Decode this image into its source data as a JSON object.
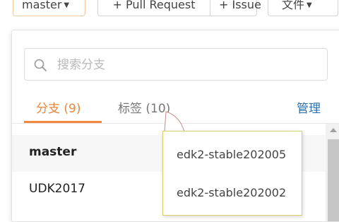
{
  "toolbar": {
    "branch_label": "master",
    "pull_request_label": "+ Pull Request",
    "issue_label": "+ Issue",
    "file_label": "文件"
  },
  "branch_panel": {
    "search_placeholder": "搜索分支",
    "tabs": [
      {
        "label": "分支 (9)",
        "active": true
      },
      {
        "label": "标签 (10)",
        "active": false
      }
    ],
    "manage_label": "管理",
    "branches": [
      {
        "name": "master",
        "current": true
      },
      {
        "name": "UDK2017",
        "current": false
      }
    ]
  },
  "tag_tooltip": {
    "items": [
      "edk2-stable202005",
      "edk2-stable202002"
    ]
  },
  "colors": {
    "accent": "#f0883e",
    "link": "#2d6fa8",
    "tooltip_border": "#d7cf6a"
  },
  "icons": {
    "search": "search-icon",
    "caret": "caret-down-icon"
  }
}
